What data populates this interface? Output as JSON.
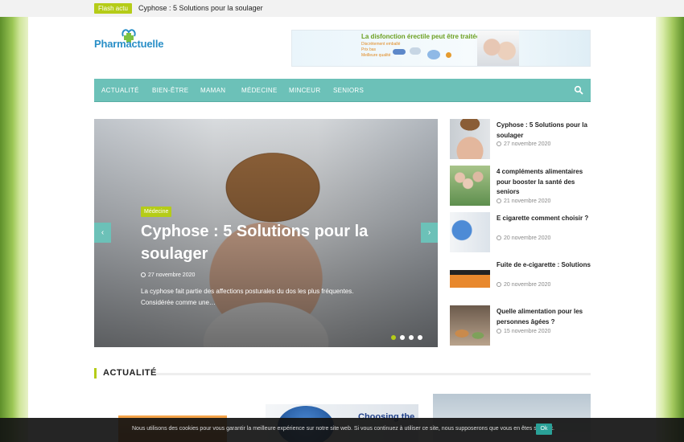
{
  "topbar": {
    "flash_label": "Flash actu",
    "flash_title": "Cyphose : 5 Solutions pour la soulager"
  },
  "logo": {
    "text": "Pharmactuelle"
  },
  "ad": {
    "headline": "La disfonction érectile peut être traitée",
    "line1": "Discrètement emballé",
    "line2": "Prix bas",
    "line3": "Meilleure qualité"
  },
  "nav": {
    "items": [
      "ACTUALITÉ",
      "BIEN-ÊTRE",
      "MAMAN",
      "MÉDECINE",
      "MINCEUR",
      "SENIORS"
    ]
  },
  "slider": {
    "category": "Médecine",
    "title": "Cyphose : 5 Solutions pour la soulager",
    "date": "27 novembre 2020",
    "excerpt": "La cyphose fait partie des affections posturales du dos les plus fréquentes. Considérée comme une…",
    "prev_arrow": "‹",
    "next_arrow": "›",
    "active_slide": 1,
    "slide_count": 4
  },
  "sidebar": {
    "items": [
      {
        "title": "Cyphose : 5 Solutions pour la soulager",
        "date": "27 novembre 2020"
      },
      {
        "title": "4 compléments alimentaires pour booster la santé des seniors",
        "date": "21 novembre 2020"
      },
      {
        "title": "E cigarette comment choisir ?",
        "date": "20 novembre 2020"
      },
      {
        "title": "Fuite de e-cigarette : Solutions",
        "date": "20 novembre 2020"
      },
      {
        "title": "Quelle alimentation pour les personnes âgées ?",
        "date": "15 novembre 2020"
      }
    ]
  },
  "section": {
    "title": "ACTUALITÉ"
  },
  "cards": {
    "card2_text": "Choosing the"
  },
  "cookie": {
    "text": "Nous utilisons des cookies pour vous garantir la meilleure expérience sur notre site web. Si vous continuez à utiliser ce site, nous supposerons que vous en êtes satisfait.",
    "button": "Ok"
  },
  "colors": {
    "accent_green": "#b5cc18",
    "nav_teal": "#6cc1b8",
    "logo_blue": "#2a8fc7"
  }
}
